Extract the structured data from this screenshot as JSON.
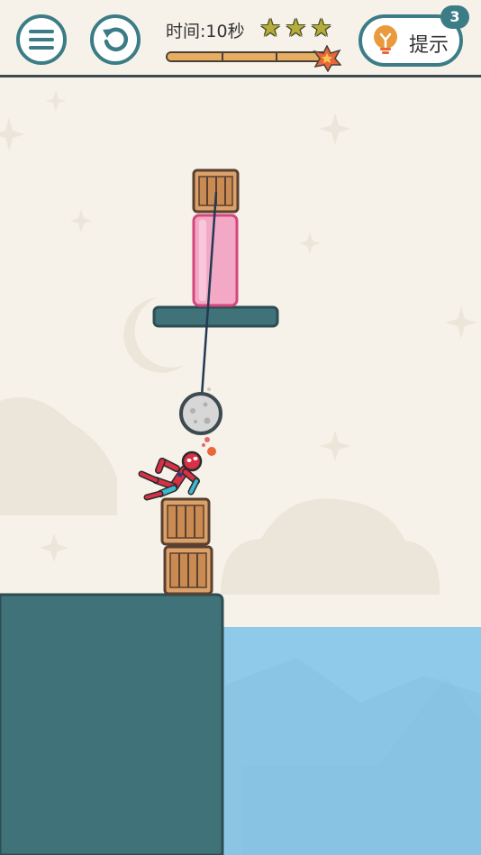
{
  "hud": {
    "timer_text": "时间:10秒",
    "stars_earned": 3,
    "stars_total": 3,
    "time_progress": 1.0,
    "hint_label": "提示",
    "hint_count": "3",
    "menu_icon": "hamburger-menu-icon",
    "restart_icon": "restart-arrow-icon",
    "hint_icon": "lightbulb-icon"
  },
  "colors": {
    "accent": "#3b7c86",
    "background": "#f6f2ea",
    "water": "#8fcaea",
    "ground": "#3f7279",
    "crate": "#dba169",
    "pink_block": "#f3a9c6"
  }
}
